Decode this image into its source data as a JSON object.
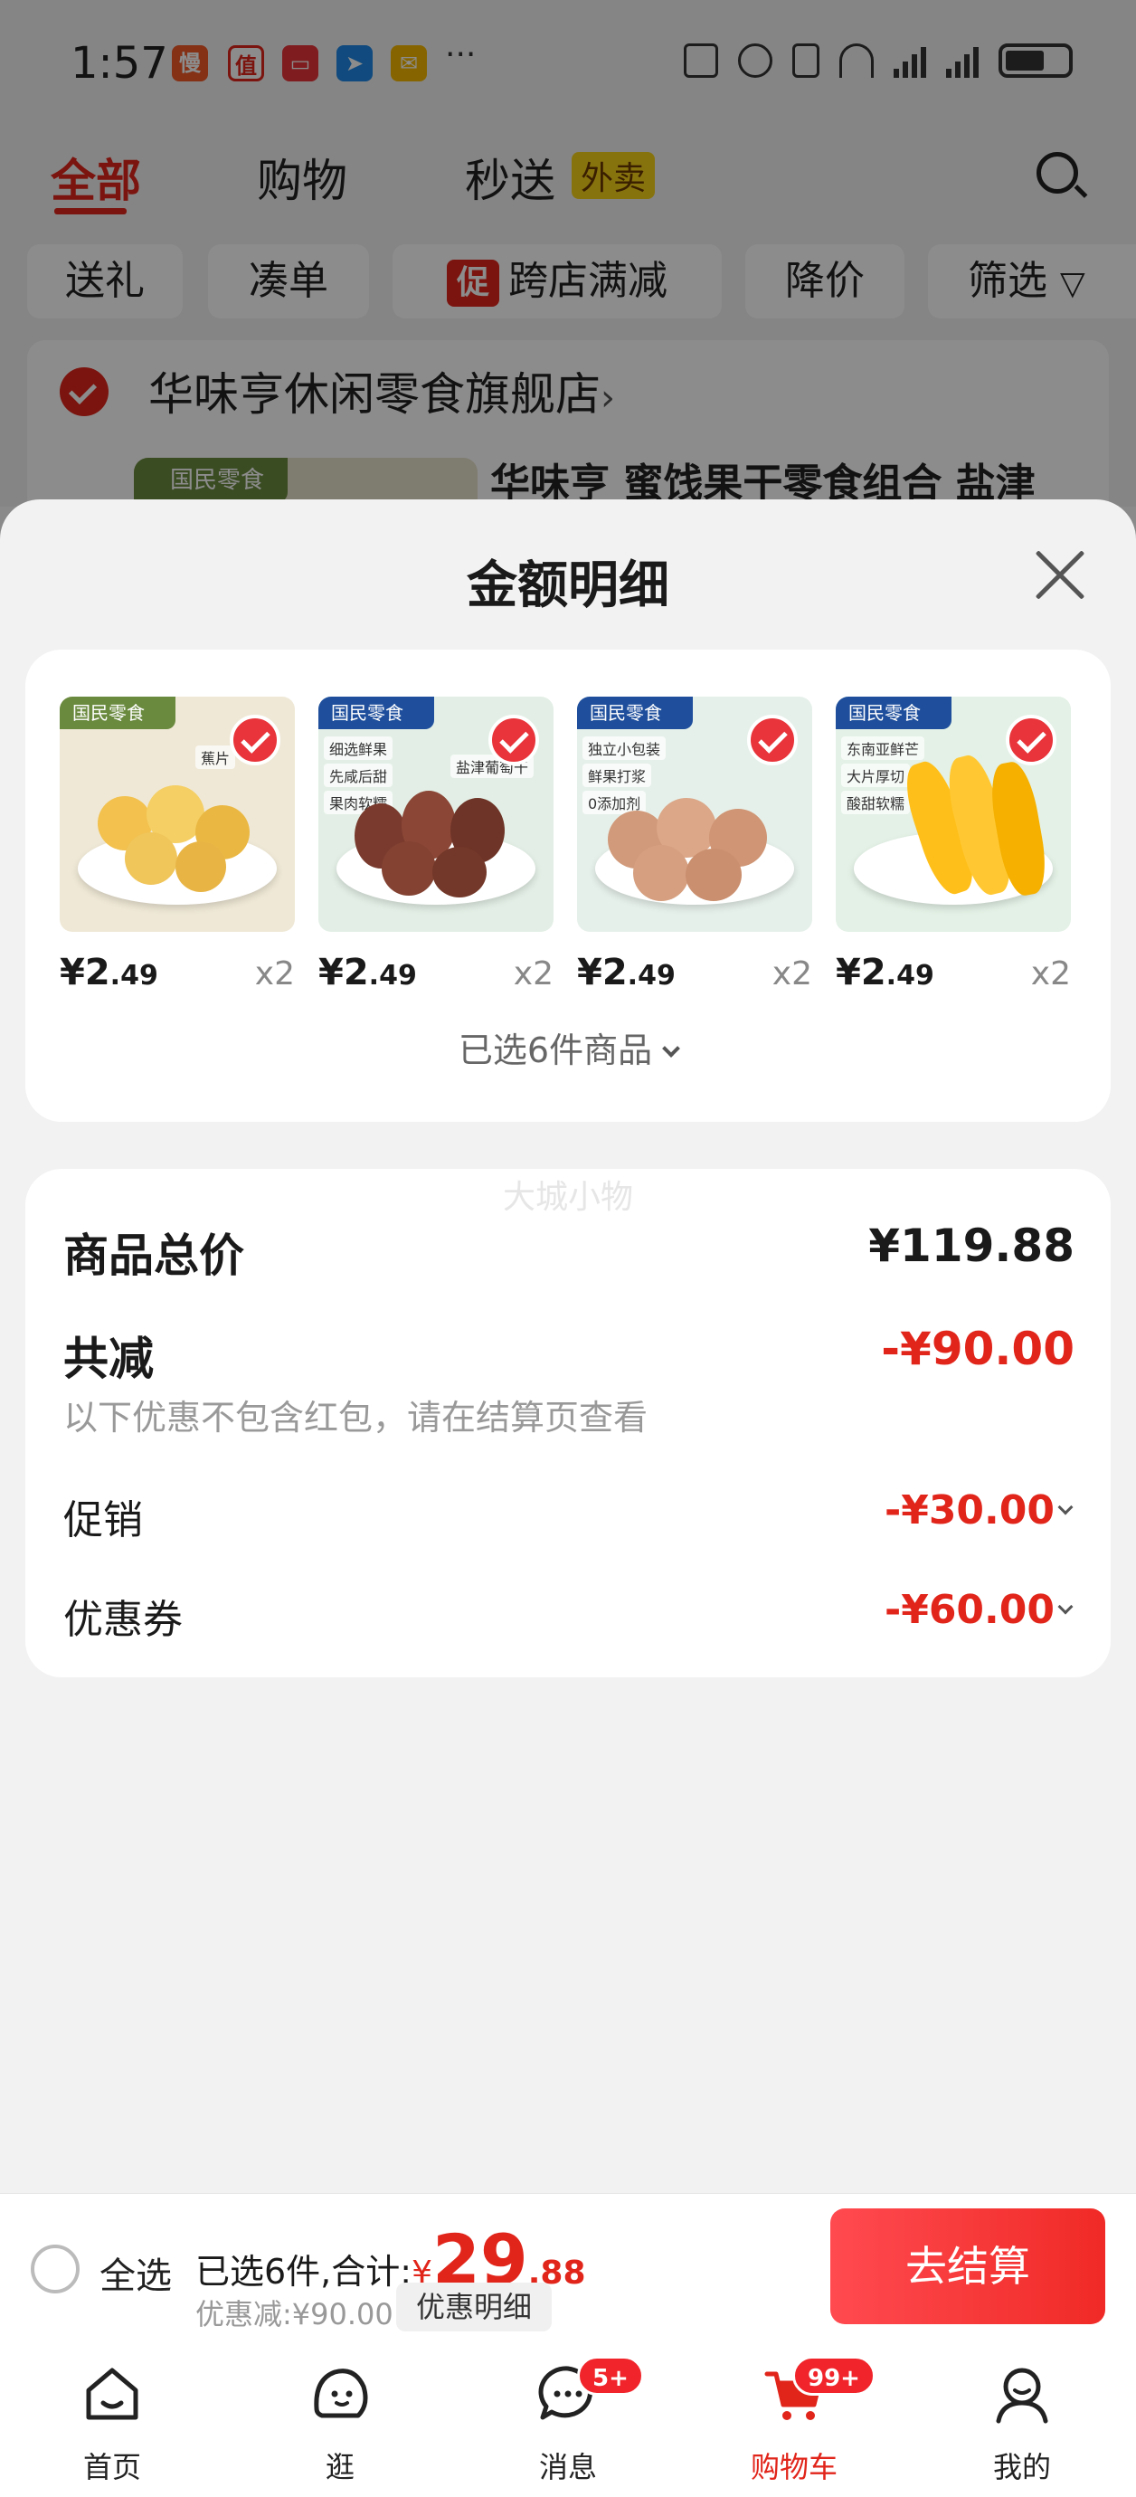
{
  "status_bar": {
    "time": "1:57",
    "notifications": [
      {
        "icon": "slow-app-icon",
        "glyph": "慢",
        "color": "#f05a28"
      },
      {
        "icon": "value-app-icon",
        "glyph": "值",
        "color": "#e1251b"
      },
      {
        "icon": "book-app-icon",
        "glyph": "▭",
        "color": "#e8343a"
      },
      {
        "icon": "arrow-app-icon",
        "glyph": "➤",
        "color": "#1e88e5"
      },
      {
        "icon": "mail-app-icon",
        "glyph": "✉",
        "color": "#f5b800"
      }
    ],
    "more": "···"
  },
  "top_tabs": {
    "all": "全部",
    "shopping": "购物",
    "instant": "秒送",
    "instant_badge": "外卖"
  },
  "filters": {
    "gift": "送礼",
    "combine": "凑单",
    "promo_tag": "促",
    "cross_store": "跨店满减",
    "price_drop": "降价",
    "filter": "筛选"
  },
  "store": {
    "name": "华味亨休闲零食旗舰店",
    "arrow": "›",
    "thumb_brand": "国民零食",
    "product_title": "华味亨 蜜饯果干零食组合 盐津"
  },
  "sheet": {
    "title": "金额明细",
    "products": [
      {
        "brand": "国民零食",
        "tags": [
          "蕉片"
        ],
        "price_int": "¥2",
        "price_dec": ".49",
        "qty": "x2",
        "brand_color": "#6a8a3e",
        "bg": "#efe8d6",
        "food": "#f2c14e"
      },
      {
        "brand": "国民零食",
        "tags": [
          "细选鲜果",
          "先咸后甜",
          "果肉软糯",
          "盐津葡萄干"
        ],
        "price_int": "¥2",
        "price_dec": ".49",
        "qty": "x2",
        "brand_color": "#1f4f9c",
        "bg": "#e3efe6",
        "food": "#7a3b2e"
      },
      {
        "brand": "国民零食",
        "tags": [
          "独立小包装",
          "鲜果打浆",
          "0添加剂"
        ],
        "price_int": "¥2",
        "price_dec": ".49",
        "qty": "x2",
        "brand_color": "#1f4f9c",
        "bg": "#e6f0ea",
        "food": "#d19a7a"
      },
      {
        "brand": "国民零食",
        "tags": [
          "东南亚鲜芒",
          "大片厚切",
          "酸甜软糯"
        ],
        "price_int": "¥2",
        "price_dec": ".49",
        "qty": "x2",
        "brand_color": "#1f4f9c",
        "bg": "#e3f1e6",
        "food": "#ffbf1a"
      }
    ],
    "selected_text": "已选6件商品",
    "watermark": "大城小物",
    "summary": {
      "total_label": "商品总价",
      "total_value": "¥119.88",
      "discount_label": "共减",
      "discount_value": "-¥90.00",
      "discount_note": "以下优惠不包含红包，请在结算页查看",
      "promo_label": "促销",
      "promo_value": "-¥30.00",
      "coupon_label": "优惠券",
      "coupon_value": "-¥60.00"
    }
  },
  "checkout": {
    "select_all": "全选",
    "summary_prefix": "已选6件,合计:",
    "currency": "¥",
    "amount_int": "29",
    "amount_dec": ".88",
    "discount_text": "优惠减:¥90.00",
    "detail_button": "优惠明细",
    "pay_button": "去结算"
  },
  "bottom_nav": {
    "home": "首页",
    "browse": "逛",
    "messages": "消息",
    "messages_badge": "5+",
    "cart": "购物车",
    "cart_badge": "99+",
    "mine": "我的"
  },
  "colors": {
    "accent_red": "#e1251b",
    "pay_button": "#f02a26",
    "badge_red": "#f0242a"
  }
}
